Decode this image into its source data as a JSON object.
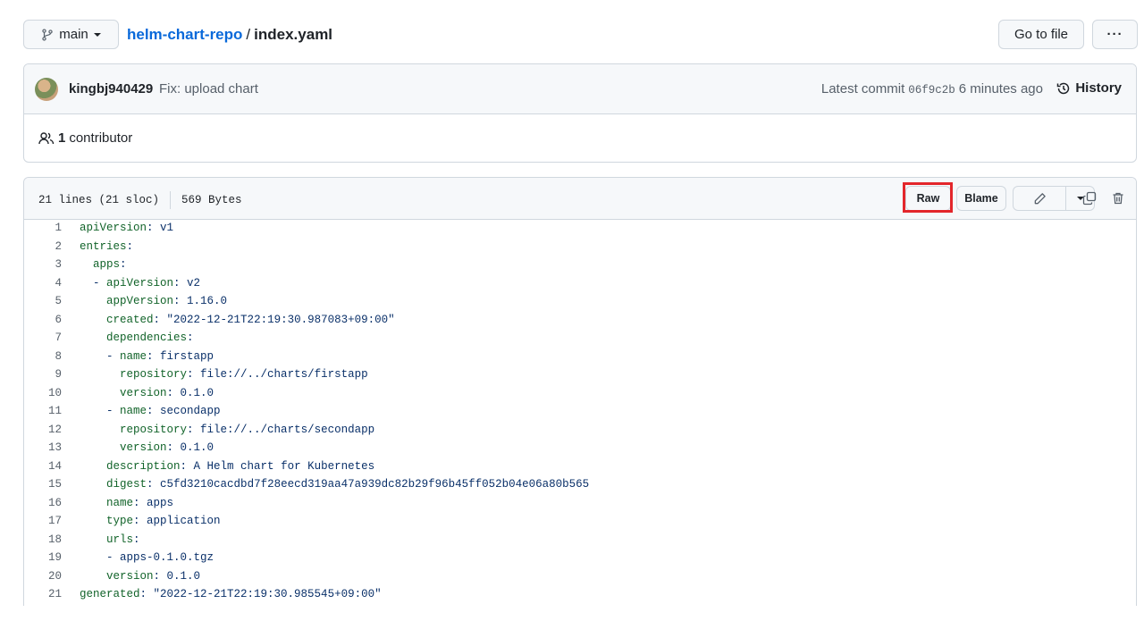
{
  "branch": {
    "name": "main"
  },
  "breadcrumb": {
    "repo": "helm-chart-repo",
    "separator": "/",
    "file": "index.yaml"
  },
  "actions": {
    "go_to_file": "Go to file",
    "more": "···"
  },
  "commit": {
    "author": "kingbj940429",
    "message": "Fix: upload chart",
    "latest_label": "Latest commit",
    "sha": "06f9c2b",
    "time": "6 minutes ago",
    "history_label": "History",
    "contributor_count": "1",
    "contributor_label": "contributor"
  },
  "file": {
    "lines_info": "21 lines (21 sloc)",
    "size": "569 Bytes",
    "raw_label": "Raw",
    "blame_label": "Blame",
    "highlight_color": "#e3262b"
  },
  "code_lines": [
    {
      "n": "1",
      "indent": "",
      "key": "apiVersion",
      "val": "v1"
    },
    {
      "n": "2",
      "indent": "",
      "key": "entries",
      "val": ""
    },
    {
      "n": "3",
      "indent": "  ",
      "key": "apps",
      "val": ""
    },
    {
      "n": "4",
      "indent": "  - ",
      "key": "apiVersion",
      "val": "v2"
    },
    {
      "n": "5",
      "indent": "    ",
      "key": "appVersion",
      "val": "1.16.0"
    },
    {
      "n": "6",
      "indent": "    ",
      "key": "created",
      "val": "\"2022-12-21T22:19:30.987083+09:00\""
    },
    {
      "n": "7",
      "indent": "    ",
      "key": "dependencies",
      "val": ""
    },
    {
      "n": "8",
      "indent": "    - ",
      "key": "name",
      "val": "firstapp"
    },
    {
      "n": "9",
      "indent": "      ",
      "key": "repository",
      "val": "file://../charts/firstapp"
    },
    {
      "n": "10",
      "indent": "      ",
      "key": "version",
      "val": "0.1.0"
    },
    {
      "n": "11",
      "indent": "    - ",
      "key": "name",
      "val": "secondapp"
    },
    {
      "n": "12",
      "indent": "      ",
      "key": "repository",
      "val": "file://../charts/secondapp"
    },
    {
      "n": "13",
      "indent": "      ",
      "key": "version",
      "val": "0.1.0"
    },
    {
      "n": "14",
      "indent": "    ",
      "key": "description",
      "val": "A Helm chart for Kubernetes"
    },
    {
      "n": "15",
      "indent": "    ",
      "key": "digest",
      "val": "c5fd3210cacdbd7f28eecd319aa47a939dc82b29f96b45ff052b04e06a80b565"
    },
    {
      "n": "16",
      "indent": "    ",
      "key": "name",
      "val": "apps"
    },
    {
      "n": "17",
      "indent": "    ",
      "key": "type",
      "val": "application"
    },
    {
      "n": "18",
      "indent": "    ",
      "key": "urls",
      "val": ""
    },
    {
      "n": "19",
      "indent": "    - ",
      "key": "",
      "val": "apps-0.1.0.tgz"
    },
    {
      "n": "20",
      "indent": "    ",
      "key": "version",
      "val": "0.1.0"
    },
    {
      "n": "21",
      "indent": "",
      "key": "generated",
      "val": "\"2022-12-21T22:19:30.985545+09:00\""
    }
  ]
}
